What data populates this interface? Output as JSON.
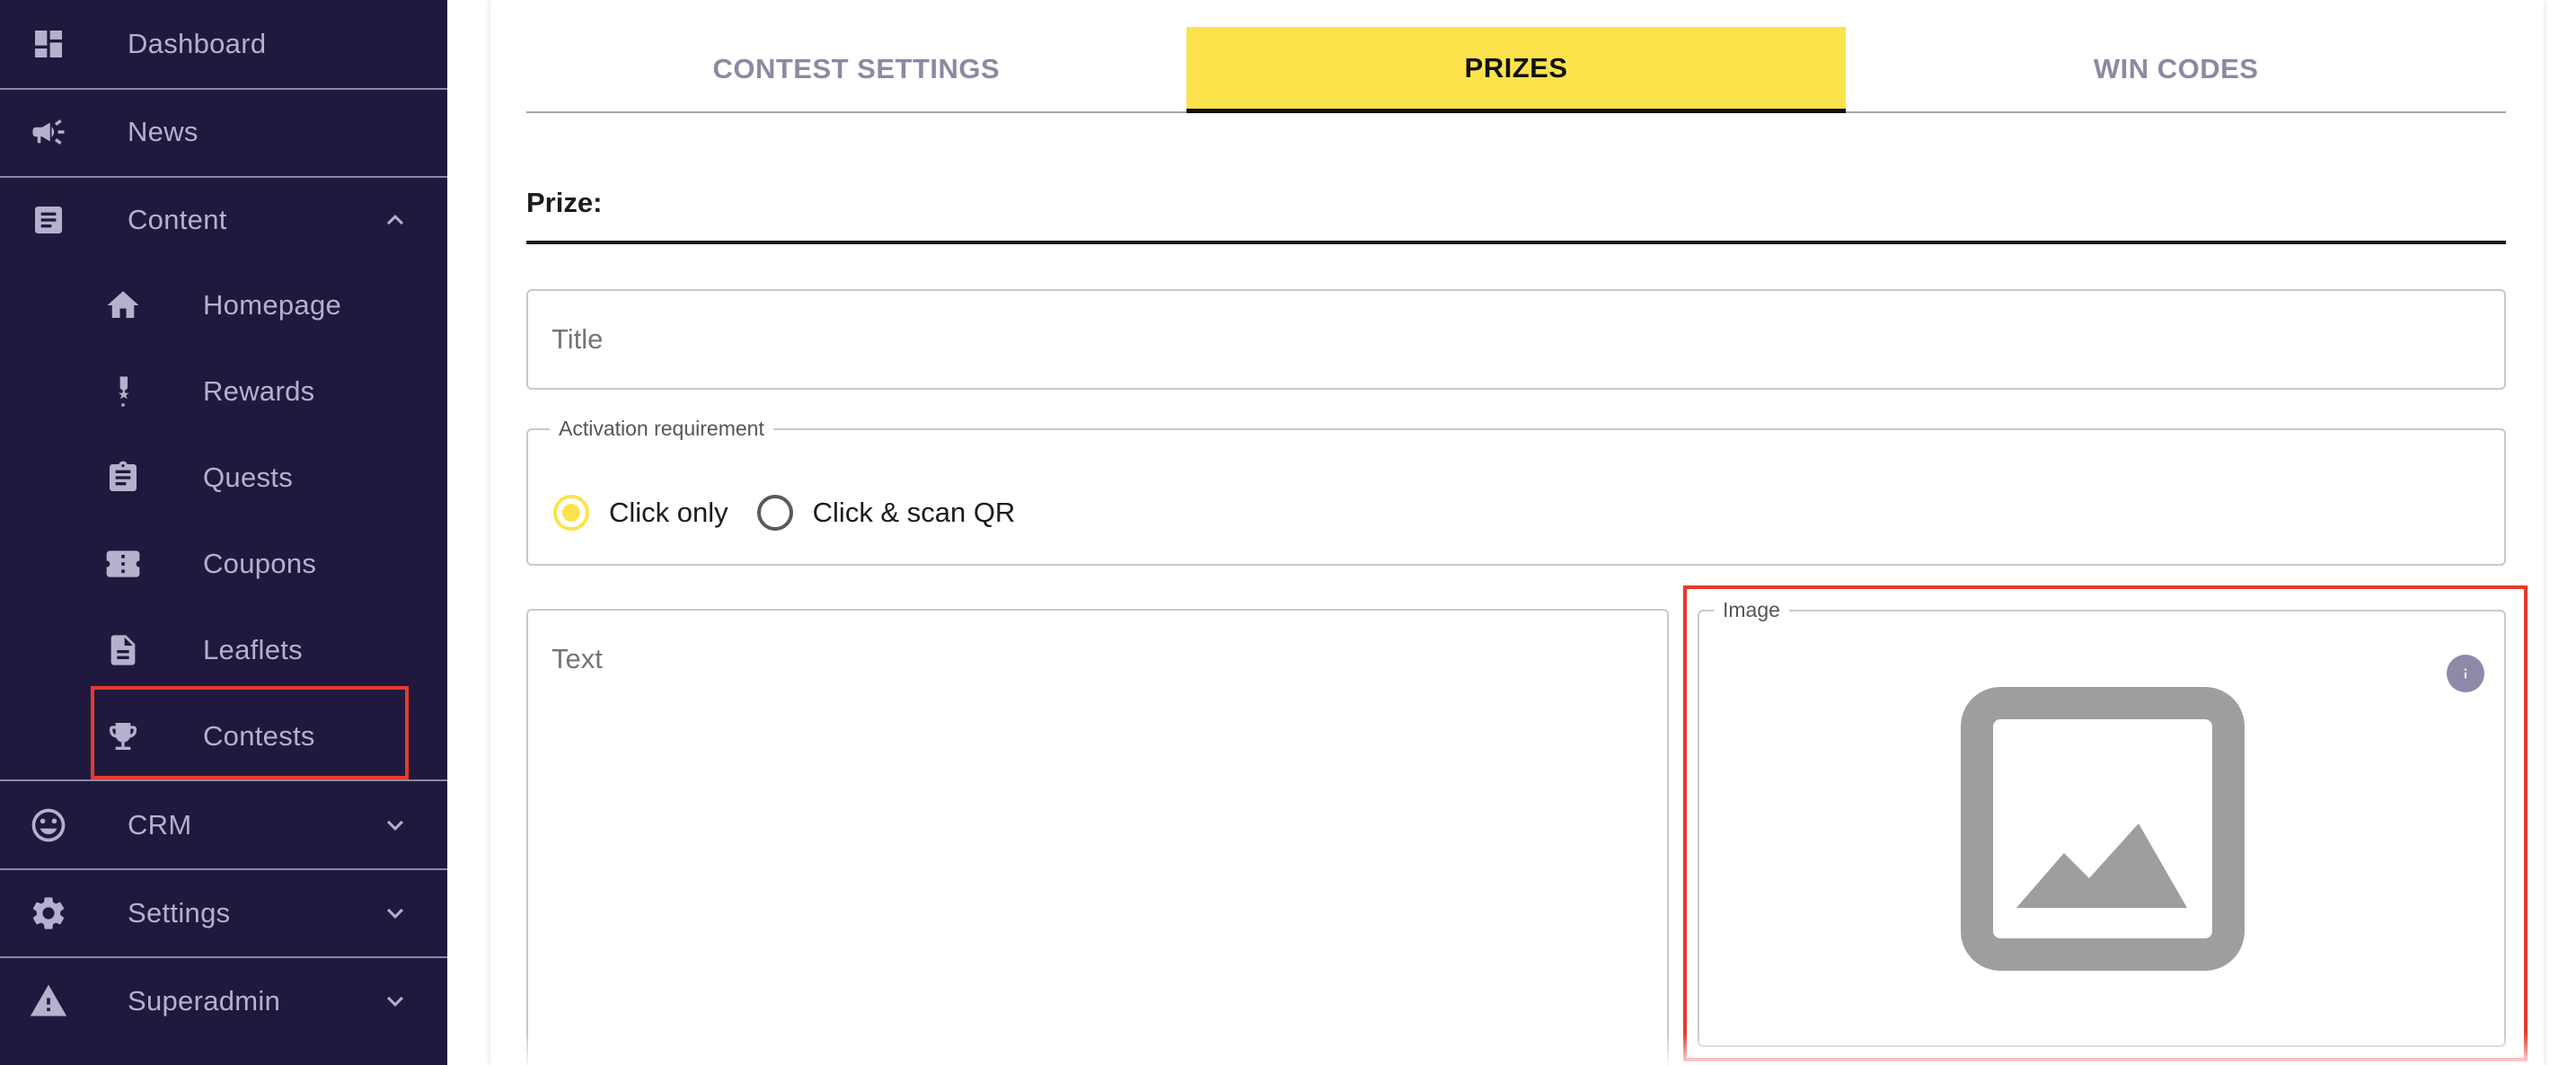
{
  "sidebar": {
    "items": [
      {
        "label": "Dashboard",
        "icon": "dashboard-icon"
      },
      {
        "label": "News",
        "icon": "megaphone-icon"
      },
      {
        "label": "Content",
        "icon": "article-icon",
        "expanded": true,
        "children": [
          {
            "label": "Homepage",
            "icon": "home-icon"
          },
          {
            "label": "Rewards",
            "icon": "medal-icon"
          },
          {
            "label": "Quests",
            "icon": "clipboard-icon"
          },
          {
            "label": "Coupons",
            "icon": "ticket-icon"
          },
          {
            "label": "Leaflets",
            "icon": "document-icon"
          },
          {
            "label": "Contests",
            "icon": "trophy-icon",
            "highlighted": true
          }
        ]
      },
      {
        "label": "CRM",
        "icon": "smiley-icon",
        "expanded": false
      },
      {
        "label": "Settings",
        "icon": "gear-icon",
        "expanded": false
      },
      {
        "label": "Superadmin",
        "icon": "warning-icon",
        "expanded": false
      }
    ]
  },
  "tabs": [
    {
      "label": "CONTEST SETTINGS",
      "active": false
    },
    {
      "label": "PRIZES",
      "active": true
    },
    {
      "label": "WIN CODES",
      "active": false
    }
  ],
  "prize_form": {
    "section_label": "Prize:",
    "title_placeholder": "Title",
    "activation": {
      "legend": "Activation requirement",
      "options": [
        {
          "label": "Click only",
          "selected": true
        },
        {
          "label": "Click & scan QR",
          "selected": false
        }
      ]
    },
    "text_placeholder": "Text",
    "image_legend": "Image"
  },
  "colors": {
    "sidebar_bg": "#1f1a3d",
    "accent_yellow": "#fde34b",
    "highlight_red": "#e53b2c",
    "sidebar_text": "#b4b1cc"
  }
}
